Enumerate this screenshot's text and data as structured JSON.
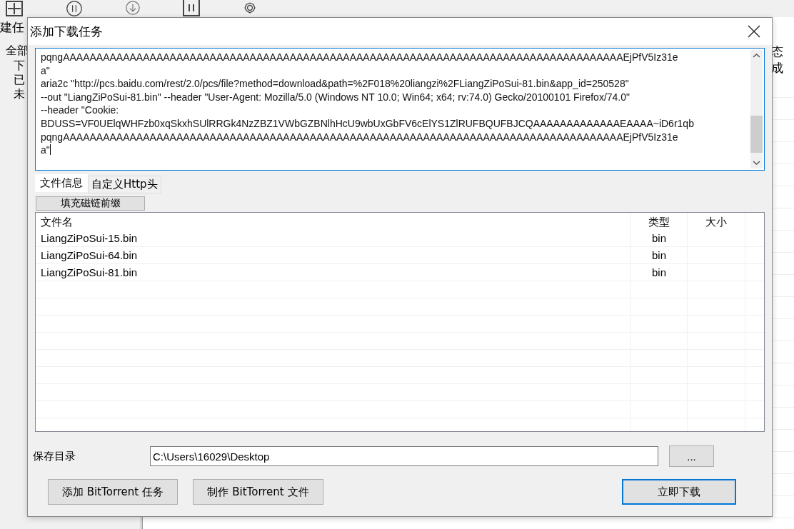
{
  "background_app": {
    "toolbar": {
      "label": "建任"
    },
    "tree": {
      "label": "全部",
      "children": [
        {
          "label": "下"
        },
        {
          "label": "已"
        },
        {
          "label": "未"
        }
      ]
    },
    "list": {
      "column_header": "态",
      "cell": "成"
    }
  },
  "dialog": {
    "title": "添加下载任务",
    "command_text": {
      "lines": [
        "pqngAAAAAAAAAAAAAAAAAAAAAAAAAAAAAAAAAAAAAAAAAAAAAAAAAAAAAAAAAAAAAAAAAAAAAAAAAAAAAAAAAAAAEjPfV5Iz31e",
        "a\"",
        "aria2c \"http://pcs.baidu.com/rest/2.0/pcs/file?method=download&path=%2F018%20liangzi%2FLiangZiPoSui-81.bin&app_id=250528\"",
        "--out \"LiangZiPoSui-81.bin\" --header \"User-Agent: Mozilla/5.0 (Windows NT 10.0; Win64; x64; rv:74.0) Gecko/20100101 Firefox/74.0\"",
        "--header \"Cookie:",
        "BDUSS=VF0UElqWHFzb0xqSkxhSUlRRGk4NzZBZ1VWbGZBNlhHcU9wbUxGbFV6cElYS1ZlRUFBQUFBJCQAAAAAAAAAAAAAEAAAA~iD6r1qb",
        "pqngAAAAAAAAAAAAAAAAAAAAAAAAAAAAAAAAAAAAAAAAAAAAAAAAAAAAAAAAAAAAAAAAAAAAAAAAAAAAAAAAAAAAEjPfV5Iz31e",
        "a\""
      ]
    },
    "tabs": [
      {
        "label": "文件信息",
        "selected": true
      },
      {
        "label": "自定义Http头",
        "selected": false
      }
    ],
    "fill_button": "填充磁链前缀",
    "file_table": {
      "columns": [
        "文件名",
        "类型",
        "大小"
      ],
      "rows": [
        {
          "name": "LiangZiPoSui-15.bin",
          "type": "bin"
        },
        {
          "name": "LiangZiPoSui-64.bin",
          "type": "bin"
        },
        {
          "name": "LiangZiPoSui-81.bin",
          "type": "bin"
        }
      ]
    },
    "save_dir": {
      "label": "保存目录",
      "value": "C:\\Users\\16029\\Desktop"
    },
    "browse_button": "...",
    "buttons": [
      {
        "label": "添加 BitTorrent 任务",
        "default": false
      },
      {
        "label": "制作 BitTorrent 文件",
        "default": false
      },
      {
        "label": "立即下载",
        "default": true
      }
    ]
  }
}
